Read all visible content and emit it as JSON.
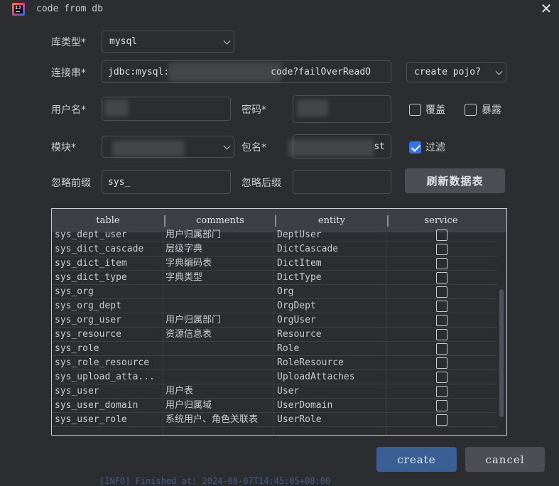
{
  "window": {
    "title": "code from db"
  },
  "form": {
    "db_type": {
      "label": "库类型*",
      "value": "mysql"
    },
    "connection": {
      "label": "连接串*",
      "value_prefix": "jdbc:mysql:",
      "value_suffix": "code?failOverReadO"
    },
    "generate_type": {
      "value": "create pojo?"
    },
    "username": {
      "label": "用户名*"
    },
    "password": {
      "label": "密码*"
    },
    "overwrite": {
      "label": "覆盖",
      "checked": false
    },
    "expose": {
      "label": "暴露",
      "checked": false
    },
    "module": {
      "label": "模块*"
    },
    "package": {
      "label": "包名*",
      "value_suffix": "st"
    },
    "filter": {
      "label": "过滤",
      "checked": true
    },
    "ignore_prefix": {
      "label": "忽略前缀",
      "value": "sys_"
    },
    "ignore_suffix": {
      "label": "忽略后缀",
      "value": ""
    },
    "refresh_label": "刷新数据表"
  },
  "table": {
    "columns": [
      "table",
      "comments",
      "entity",
      "service"
    ],
    "rows": [
      {
        "table": "sys_dept_user",
        "comments": "用户归属部门",
        "entity": "DeptUser",
        "service": false
      },
      {
        "table": "sys_dict_cascade",
        "comments": "层级字典",
        "entity": "DictCascade",
        "service": false
      },
      {
        "table": "sys_dict_item",
        "comments": "字典编码表",
        "entity": "DictItem",
        "service": false
      },
      {
        "table": "sys_dict_type",
        "comments": "字典类型",
        "entity": "DictType",
        "service": false
      },
      {
        "table": "sys_org",
        "comments": "",
        "entity": "Org",
        "service": false
      },
      {
        "table": "sys_org_dept",
        "comments": "",
        "entity": "OrgDept",
        "service": false
      },
      {
        "table": "sys_org_user",
        "comments": "用户归属部门",
        "entity": "OrgUser",
        "service": false
      },
      {
        "table": "sys_resource",
        "comments": "资源信息表",
        "entity": "Resource",
        "service": false
      },
      {
        "table": "sys_role",
        "comments": "",
        "entity": "Role",
        "service": false
      },
      {
        "table": "sys_role_resource",
        "comments": "",
        "entity": "RoleResource",
        "service": false
      },
      {
        "table": "sys_upload_atta...",
        "comments": "",
        "entity": "UploadAttaches",
        "service": false
      },
      {
        "table": "sys_user",
        "comments": "用户表",
        "entity": "User",
        "service": false
      },
      {
        "table": "sys_user_domain",
        "comments": "用户归属域",
        "entity": "UserDomain",
        "service": false
      },
      {
        "table": "sys_user_role",
        "comments": "系统用户、角色关联表",
        "entity": "UserRole",
        "service": false
      }
    ]
  },
  "buttons": {
    "create": "create",
    "cancel": "cancel"
  },
  "background_text": "[INFO] Finished at: 2024-08-07T14:45:05+08:00",
  "colors": {
    "background": "#2b2d30",
    "accent": "#3574f0",
    "primary_button": "#3a5f95"
  }
}
